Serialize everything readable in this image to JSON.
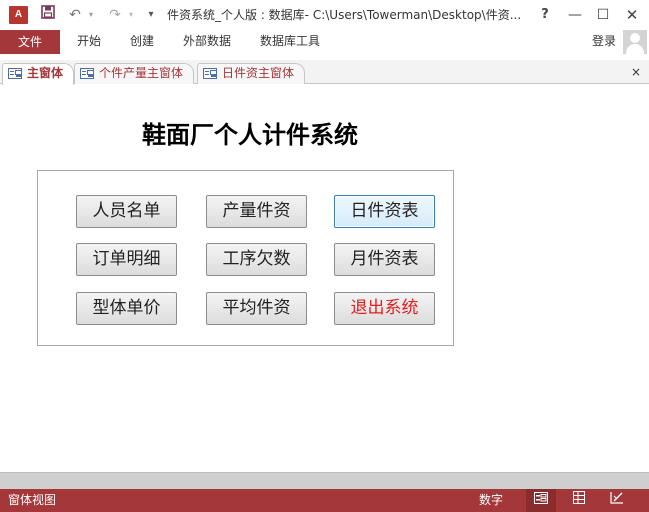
{
  "titlebar": {
    "app_icon": "A",
    "title": "件资系统_个人版 : 数据库- C:\\Users\\Towerman\\Desktop\\件资...",
    "icons": {
      "save": "save-icon",
      "undo": "undo-icon",
      "redo": "redo-icon",
      "customize": "customize-icon"
    },
    "window_buttons": {
      "help": "?",
      "minimize": "—",
      "maximize": "☐",
      "close": "✕"
    }
  },
  "ribbon": {
    "file_label": "文件",
    "tabs": [
      "开始",
      "创建",
      "外部数据",
      "数据库工具"
    ],
    "signin_label": "登录"
  },
  "doc_tabs": [
    {
      "label": "主窗体",
      "active": true
    },
    {
      "label": "个件产量主窗体",
      "active": false
    },
    {
      "label": "日件资主窗体",
      "active": false
    }
  ],
  "doc_close": "×",
  "form": {
    "title": "鞋面厂个人计件系统",
    "buttons": {
      "personnel": "人员名单",
      "output_wage": "产量件资",
      "daily_report": "日件资表",
      "order_detail": "订单明细",
      "process_owed": "工序欠数",
      "monthly_report": "月件资表",
      "model_price": "型体单价",
      "avg_wage": "平均件资",
      "exit": "退出系统"
    }
  },
  "status": {
    "view_name": "窗体视图",
    "num_lock": "数字"
  },
  "colors": {
    "accent": "#a4373a",
    "exit_text": "#e21f1f",
    "focus_border": "#3c7fb1"
  }
}
